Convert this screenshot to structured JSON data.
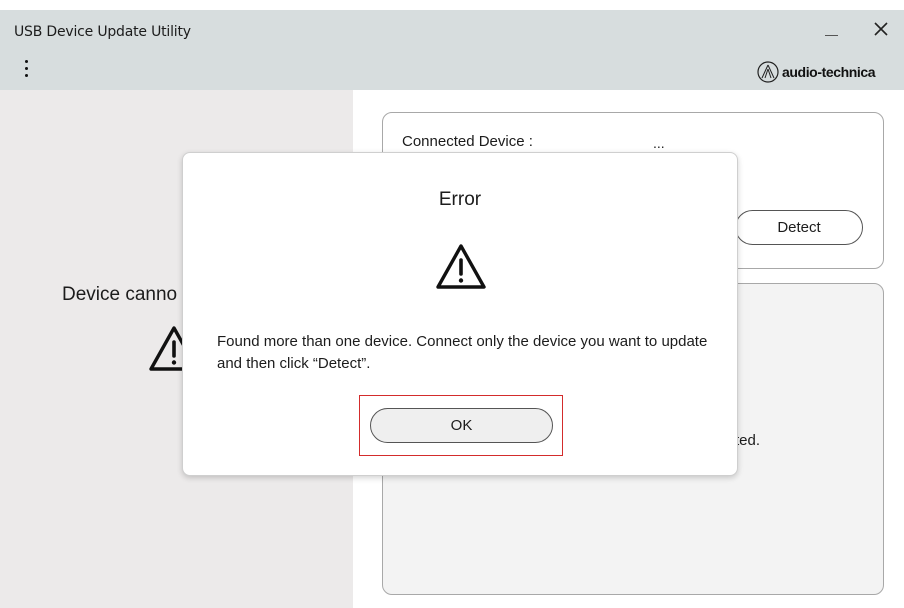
{
  "window": {
    "title": "USB Device Update Utility",
    "minimize_icon": "minimize-icon",
    "close_icon": "close-icon"
  },
  "toolbar": {
    "menu_icon": "kebab-menu-icon",
    "brand": "audio-technica"
  },
  "left_panel": {
    "message_partial": "Device canno",
    "icon": "warning-icon"
  },
  "device_card": {
    "connected_label": "Connected Device :",
    "connected_value": "...",
    "detect_label": "Detect"
  },
  "status_card": {
    "message_fragment": "ted."
  },
  "dialog": {
    "title": "Error",
    "icon": "warning-icon",
    "message": "Found more than one device. Connect only the device you want to update and then click “Detect”.",
    "ok_label": "OK",
    "highlight_color": "#d32c2c"
  }
}
